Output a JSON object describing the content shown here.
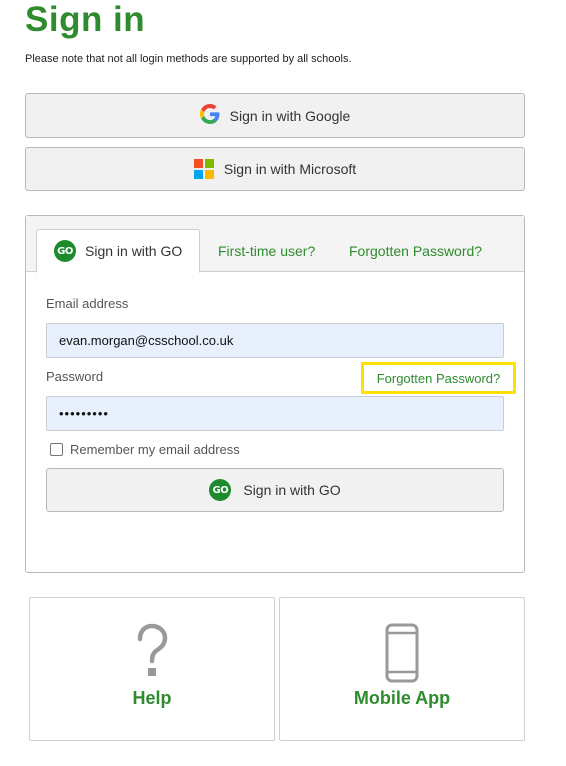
{
  "page": {
    "title": "Sign in",
    "note": "Please note that not all login methods are supported by all schools."
  },
  "sso": {
    "google_label": "Sign in with Google",
    "microsoft_label": "Sign in with Microsoft"
  },
  "tabs": [
    {
      "label": "Sign in with GO",
      "active": true
    },
    {
      "label": "First-time user?",
      "active": false
    },
    {
      "label": "Forgotten Password?",
      "active": false
    }
  ],
  "go_badge": "GO",
  "form": {
    "email_label": "Email address",
    "email_value": "evan.morgan@csschool.co.uk",
    "password_label": "Password",
    "password_value": "•••••••••",
    "forgot_link": "Forgotten Password?",
    "remember_label": "Remember my email address",
    "remember_checked": false,
    "submit_label": "Sign in with GO"
  },
  "cards": [
    {
      "label": "Help",
      "icon": "question-icon"
    },
    {
      "label": "Mobile App",
      "icon": "smartphone-icon"
    }
  ],
  "colors": {
    "brand_green": "#2e8b2e",
    "badge_green": "#1e8a2e",
    "highlight": "#ffe000",
    "input_fill": "#e8f0fe",
    "ms_red": "#f25022",
    "ms_green": "#7fba00",
    "ms_blue": "#00a4ef",
    "ms_yellow": "#ffb900"
  }
}
